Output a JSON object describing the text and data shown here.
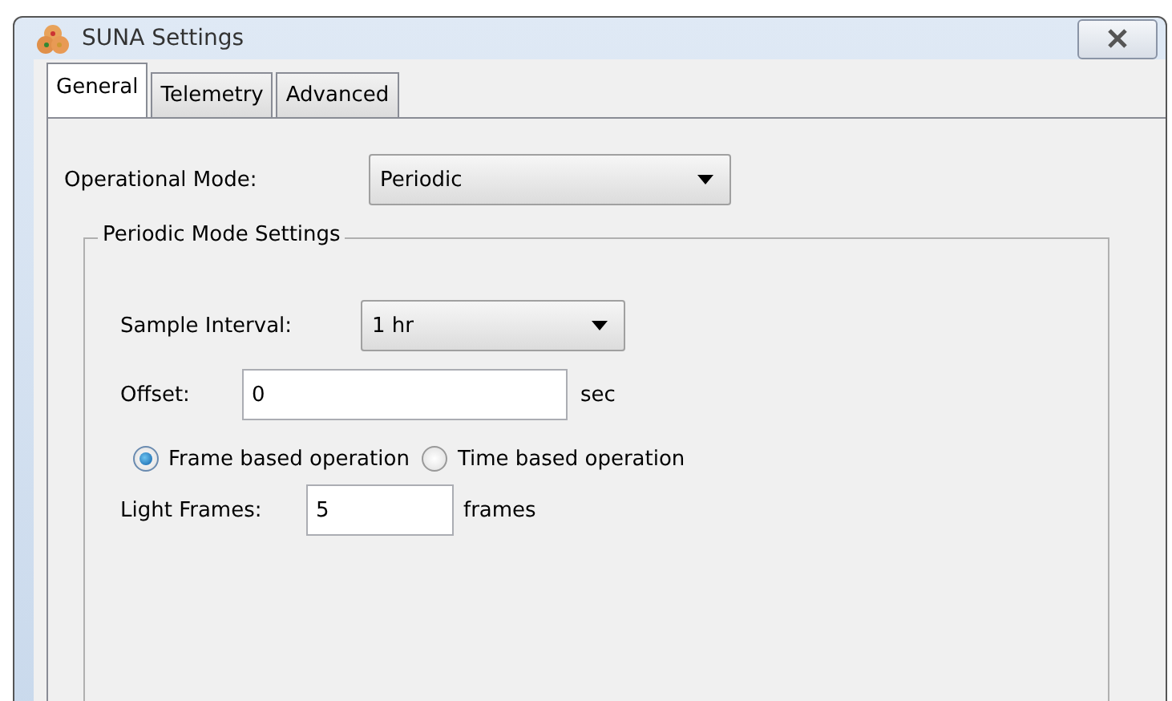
{
  "window": {
    "title": "SUNA Settings"
  },
  "tabs": [
    {
      "label": "General",
      "selected": true
    },
    {
      "label": "Telemetry",
      "selected": false
    },
    {
      "label": "Advanced",
      "selected": false
    }
  ],
  "operational_mode": {
    "label": "Operational Mode:",
    "value": "Periodic"
  },
  "group": {
    "title": "Periodic Mode Settings",
    "sample_interval": {
      "label": "Sample Interval:",
      "value": "1 hr"
    },
    "offset": {
      "label": "Offset:",
      "value": "0",
      "unit": "sec"
    },
    "radios": [
      {
        "label": "Frame based operation",
        "selected": true
      },
      {
        "label": "Time based operation",
        "selected": false
      }
    ],
    "light_frames": {
      "label": "Light Frames:",
      "value": "5",
      "unit": "frames"
    }
  }
}
